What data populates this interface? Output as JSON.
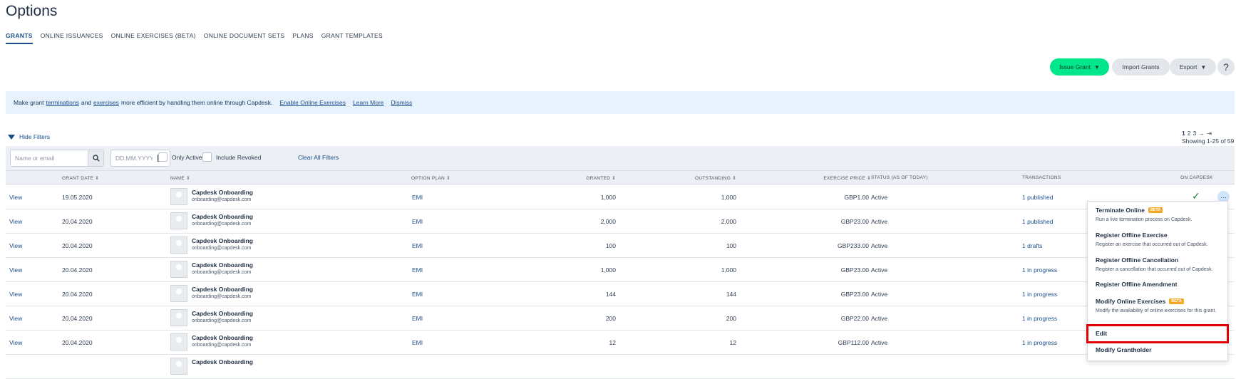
{
  "page": {
    "title": "Options"
  },
  "tabs": [
    "GRANTS",
    "ONLINE ISSUANCES",
    "ONLINE EXERCISES (BETA)",
    "ONLINE DOCUMENT SETS",
    "PLANS",
    "GRANT TEMPLATES"
  ],
  "toolbar": {
    "issue": "Issue Grant",
    "import": "Import Grants",
    "export": "Export",
    "help": "?"
  },
  "banner": {
    "t1": "Make grant",
    "l1": "terminations",
    "t2": "and",
    "l2": "exercises",
    "t3": "more efficient by handling them online through Capdesk.",
    "enable": "Enable Online Exercises",
    "learn": "Learn More",
    "dismiss": "Dismiss"
  },
  "filters": {
    "toggle": "Hide Filters",
    "search_placeholder": "Name or email",
    "date_placeholder": "DD.MM.YYYY",
    "only_active": "Only Active",
    "include_revoked": "Include Revoked",
    "clear": "Clear All Filters"
  },
  "pagination": {
    "current": "1",
    "p2": "2",
    "p3": "3",
    "next": "→",
    "last": "⇥",
    "showing": "Showing 1-25 of 59"
  },
  "columns": {
    "grant_date": "GRANT DATE ⇕",
    "name": "NAME ⇕",
    "option_plan": "OPTION PLAN ⇕",
    "granted": "GRANTED ⇕",
    "outstanding": "OUTSTANDING ⇕",
    "exercise_price": "EXERCISE PRICE ⇕",
    "status": "STATUS (AS OF TODAY)",
    "transactions": "TRANSACTIONS",
    "on_capdesk": "ON CAPDESK"
  },
  "rows": [
    {
      "view": "View",
      "date": "19.05.2020",
      "name": "Capdesk Onboarding",
      "email": "onboarding@capdesk.com",
      "plan": "EMI",
      "granted": "1,000",
      "outstanding": "1,000",
      "price": "GBP1.00",
      "status": "Active",
      "tx": "1 published"
    },
    {
      "view": "View",
      "date": "20.04.2020",
      "name": "Capdesk Onboarding",
      "email": "onboarding@capdesk.com",
      "plan": "EMI",
      "granted": "2,000",
      "outstanding": "2,000",
      "price": "GBP23.00",
      "status": "Active",
      "tx": "1 published"
    },
    {
      "view": "View",
      "date": "20.04.2020",
      "name": "Capdesk Onboarding",
      "email": "onboarding@capdesk.com",
      "plan": "EMI",
      "granted": "100",
      "outstanding": "100",
      "price": "GBP233.00",
      "status": "Active",
      "tx": "1 drafts"
    },
    {
      "view": "View",
      "date": "20.04.2020",
      "name": "Capdesk Onboarding",
      "email": "onboarding@capdesk.com",
      "plan": "EMI",
      "granted": "1,000",
      "outstanding": "1,000",
      "price": "GBP23.00",
      "status": "Active",
      "tx": "1 in progress"
    },
    {
      "view": "View",
      "date": "20.04.2020",
      "name": "Capdesk Onboarding",
      "email": "onboarding@capdesk.com",
      "plan": "EMI",
      "granted": "144",
      "outstanding": "144",
      "price": "GBP23.00",
      "status": "Active",
      "tx": "1 in progress"
    },
    {
      "view": "View",
      "date": "20.04.2020",
      "name": "Capdesk Onboarding",
      "email": "onboarding@capdesk.com",
      "plan": "EMI",
      "granted": "200",
      "outstanding": "200",
      "price": "GBP22.00",
      "status": "Active",
      "tx": "1 in progress"
    },
    {
      "view": "View",
      "date": "20.04.2020",
      "name": "Capdesk Onboarding",
      "email": "onboarding@capdesk.com",
      "plan": "EMI",
      "granted": "12",
      "outstanding": "12",
      "price": "GBP112.00",
      "status": "Active",
      "tx": "1 in progress"
    },
    {
      "view": "",
      "date": "",
      "name": "Capdesk Onboarding",
      "email": "",
      "plan": "",
      "granted": "",
      "outstanding": "",
      "price": "",
      "status": "",
      "tx": ""
    }
  ],
  "on_capdesk_mark": "✓",
  "more_label": "···",
  "menu": [
    {
      "title": "Terminate Online",
      "badge": "BETA",
      "desc": "Run a live termination process on Capdesk."
    },
    {
      "title": "Register Offline Exercise",
      "badge": "",
      "desc": "Register an exercise that occurred out of Capdesk."
    },
    {
      "title": "Register Offline Cancellation",
      "badge": "",
      "desc": "Register a cancellation that occurred out of Capdesk."
    },
    {
      "title": "Register Offline Amendment",
      "badge": "",
      "desc": ""
    },
    {
      "title": "Modify Online Exercises",
      "badge": "BETA",
      "desc": "Modify the availability of online exercises for this grant."
    },
    {
      "title": "Edit",
      "badge": "",
      "desc": ""
    },
    {
      "title": "Modify Grantholder",
      "badge": "",
      "desc": ""
    }
  ],
  "colors": {
    "accent": "#1a4f8a",
    "issue_button": "#00e68a",
    "banner": "#e7f2fc",
    "beta": "#f5a623",
    "highlight": "#e00000"
  }
}
